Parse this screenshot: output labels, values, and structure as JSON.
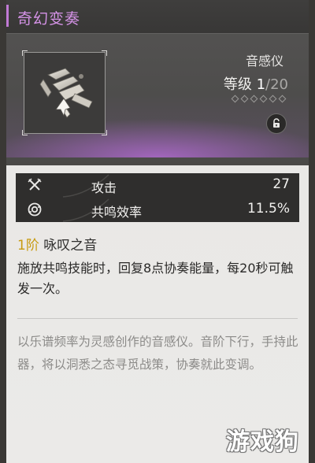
{
  "window": {
    "title": "奇幻变奏"
  },
  "item": {
    "type": "音感仪",
    "level_prefix": "等级",
    "level_current": "1",
    "level_max": "/20",
    "rank_diamonds": 6,
    "lock_icon": "unlock-icon"
  },
  "stats": [
    {
      "icon": "attack-icon",
      "label": "攻击",
      "value": "27"
    },
    {
      "icon": "resonance-efficiency-icon",
      "label": "共鸣效率",
      "value": "11.5%"
    }
  ],
  "passive": {
    "rank": "1阶",
    "name": "咏叹之音",
    "description": "施放共鸣技能时，回复8点协奏能量，每20秒可触发一次。"
  },
  "lore": "以乐谱频率为灵感创作的音感仪。音阶下行，手持此器，将以洞悉之态寻觅战策，协奏就此变调。",
  "watermark": "游戏狗",
  "colors": {
    "title": "#d492e6",
    "accent": "#c17ad4",
    "rank": "#c89a10",
    "stats_bg": "#2f2e2d",
    "lore": "#8c8b89"
  }
}
